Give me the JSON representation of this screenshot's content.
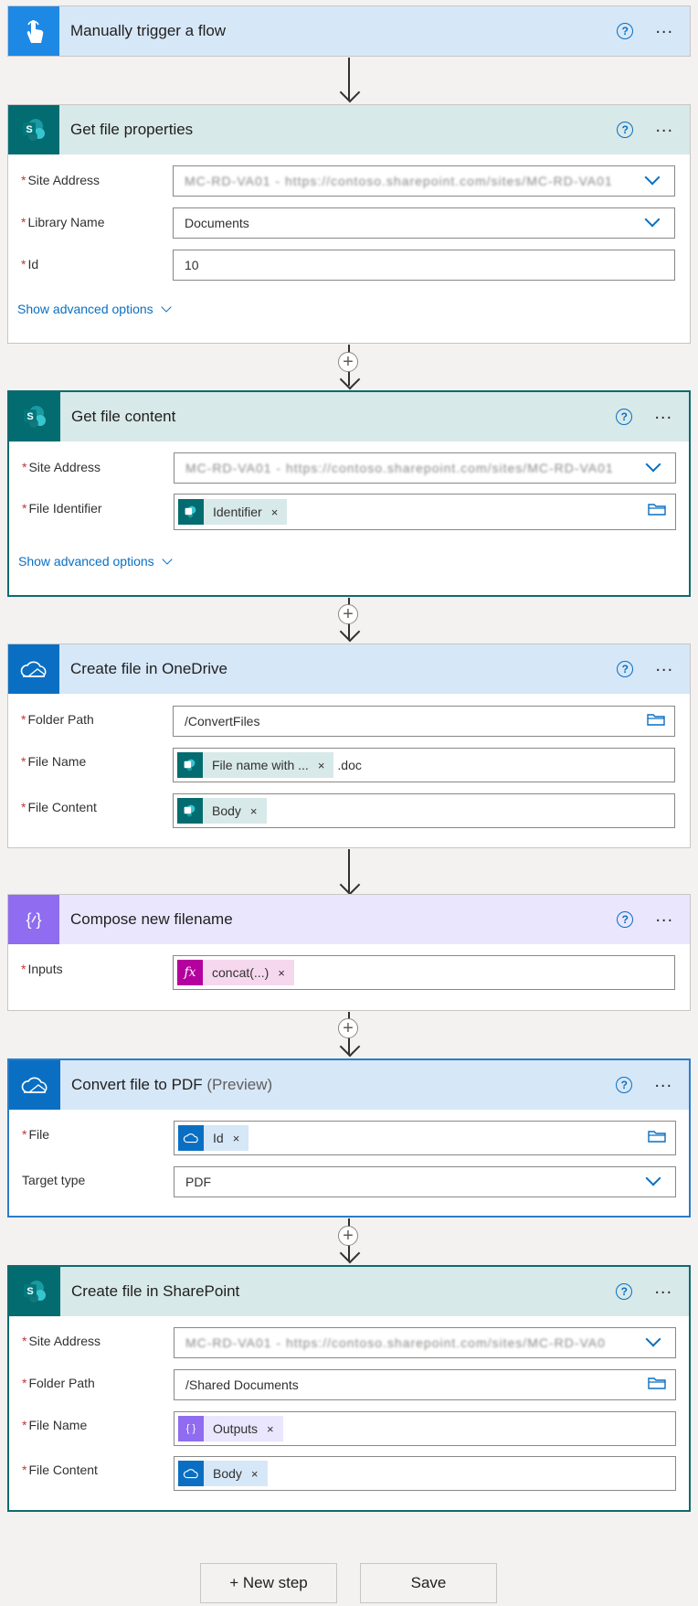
{
  "steps": {
    "trigger": {
      "title": "Manually trigger a flow"
    },
    "props": {
      "title": "Get file properties",
      "site_label": "Site Address",
      "site_value": "MC-RD-VA01 - https://contoso.sharepoint.com/sites/MC-RD-VA01",
      "lib_label": "Library Name",
      "lib_value": "Documents",
      "id_label": "Id",
      "id_value": "10",
      "advanced": "Show advanced options"
    },
    "content": {
      "title": "Get file content",
      "site_label": "Site Address",
      "site_value": "MC-RD-VA01 - https://contoso.sharepoint.com/sites/MC-RD-VA01",
      "fileid_label": "File Identifier",
      "fileid_token": "Identifier",
      "advanced": "Show advanced options"
    },
    "onedrive": {
      "title": "Create file in OneDrive",
      "folder_label": "Folder Path",
      "folder_value": "/ConvertFiles",
      "name_label": "File Name",
      "name_token": "File name with ...",
      "name_suffix": ".doc",
      "content_label": "File Content",
      "content_token": "Body"
    },
    "compose": {
      "title": "Compose new filename",
      "inputs_label": "Inputs",
      "inputs_token": "concat(...)"
    },
    "convert": {
      "title": "Convert file to PDF",
      "preview": "(Preview)",
      "file_label": "File",
      "file_token": "Id",
      "target_label": "Target type",
      "target_value": "PDF"
    },
    "spfile": {
      "title": "Create file in SharePoint",
      "site_label": "Site Address",
      "site_value": "MC-RD-VA01 - https://contoso.sharepoint.com/sites/MC-RD-VA0",
      "folder_label": "Folder Path",
      "folder_value": "/Shared Documents",
      "name_label": "File Name",
      "name_token": "Outputs",
      "content_label": "File Content",
      "content_token": "Body"
    }
  },
  "footer": {
    "new_step": "+ New step",
    "save": "Save"
  },
  "common": {
    "required": "*",
    "remove": "×",
    "more": "...",
    "help": "?",
    "plus": "+"
  },
  "colors": {
    "accent": "#0a6fc2",
    "sharepoint": "#036c70",
    "compose": "#8f6cf0",
    "trigger": "#1e88e5"
  }
}
